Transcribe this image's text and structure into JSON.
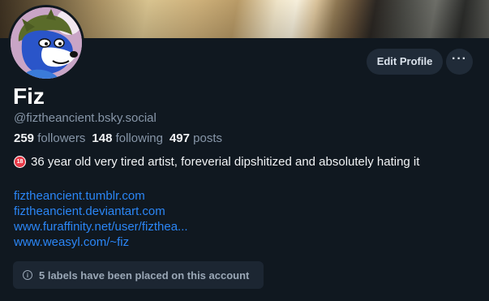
{
  "profile": {
    "display_name": "Fiz",
    "handle": "@fiztheancient.bsky.social",
    "stats": {
      "followers_count": "259",
      "followers_label": "followers",
      "following_count": "148",
      "following_label": "following",
      "posts_count": "497",
      "posts_label": "posts"
    },
    "bio": {
      "age_badge": "18",
      "text": "36 year old very tired artist, foreverial dipshitized and absolutely hating it"
    },
    "links": [
      "fiztheancient.tumblr.com",
      "fiztheancient.deviantart.com",
      "www.furaffinity.net/user/fizthea...",
      "www.weasyl.com/~fiz"
    ],
    "labels_notice": "5 labels have been placed on this account"
  },
  "actions": {
    "edit_profile": "Edit Profile",
    "more": "···"
  },
  "icons": {
    "more": "ellipsis-icon",
    "age": "age-18-icon",
    "info": "info-icon"
  },
  "colors": {
    "background": "#101820",
    "link": "#2b86f6",
    "muted_text": "#8796a8",
    "button_bg": "#202b38",
    "age_badge": "#e83a48"
  }
}
